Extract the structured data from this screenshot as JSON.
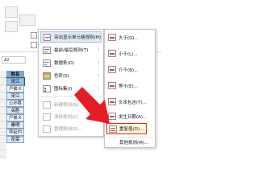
{
  "name_box": {
    "value": "A2"
  },
  "column": {
    "header": "姓名",
    "cells": [
      "宋江",
      "卢俊义",
      "宋江",
      "公孙胜",
      "关胜",
      "卢俊义",
      "秦明",
      "呼延灼",
      "花荣"
    ]
  },
  "context_menu": {
    "items": [
      {
        "label": "突出显示单元格规则(H)",
        "has_submenu": true,
        "disabled": false,
        "active": true,
        "icon": "highlight-cells-icon"
      },
      {
        "label": "最前/最后规则(T)",
        "has_submenu": true,
        "disabled": false,
        "active": false,
        "icon": "top-bottom-icon"
      },
      {
        "label": "数据条(D)",
        "has_submenu": true,
        "disabled": false,
        "active": false,
        "icon": "data-bars-icon"
      },
      {
        "label": "色阶(S)",
        "has_submenu": true,
        "disabled": false,
        "active": false,
        "icon": "color-scales-icon"
      },
      {
        "label": "图标集(I)",
        "has_submenu": true,
        "disabled": false,
        "active": false,
        "icon": "icon-sets-icon"
      },
      {
        "label": "新建规则(N)...",
        "has_submenu": false,
        "disabled": true,
        "active": false,
        "icon": "new-rule-icon"
      },
      {
        "label": "清除规则(C)",
        "has_submenu": true,
        "disabled": true,
        "active": false,
        "icon": "clear-rules-icon"
      },
      {
        "label": "管理规则(R)...",
        "has_submenu": false,
        "disabled": true,
        "active": false,
        "icon": "manage-rules-icon"
      }
    ]
  },
  "submenu": {
    "items": [
      {
        "label": "大于(G)...",
        "highlight": false,
        "icon": "greater-than-icon"
      },
      {
        "label": "小于(L)...",
        "highlight": false,
        "icon": "less-than-icon"
      },
      {
        "label": "介于(B)...",
        "highlight": false,
        "icon": "between-icon"
      },
      {
        "label": "等于(E)...",
        "highlight": false,
        "icon": "equal-to-icon"
      },
      {
        "label": "文本包含(T)...",
        "highlight": false,
        "icon": "text-contains-icon"
      },
      {
        "label": "发生日期(A)...",
        "highlight": false,
        "icon": "date-occurring-icon"
      },
      {
        "label": "重复值(D)...",
        "highlight": true,
        "icon": "duplicate-values-icon"
      }
    ],
    "footer": "其他规则(M)..."
  },
  "colors": {
    "highlight_border": "#e0262a",
    "arrow": "#e41e26",
    "header_fill": "#7fa7d9",
    "band_fill": "#dce8f5"
  }
}
